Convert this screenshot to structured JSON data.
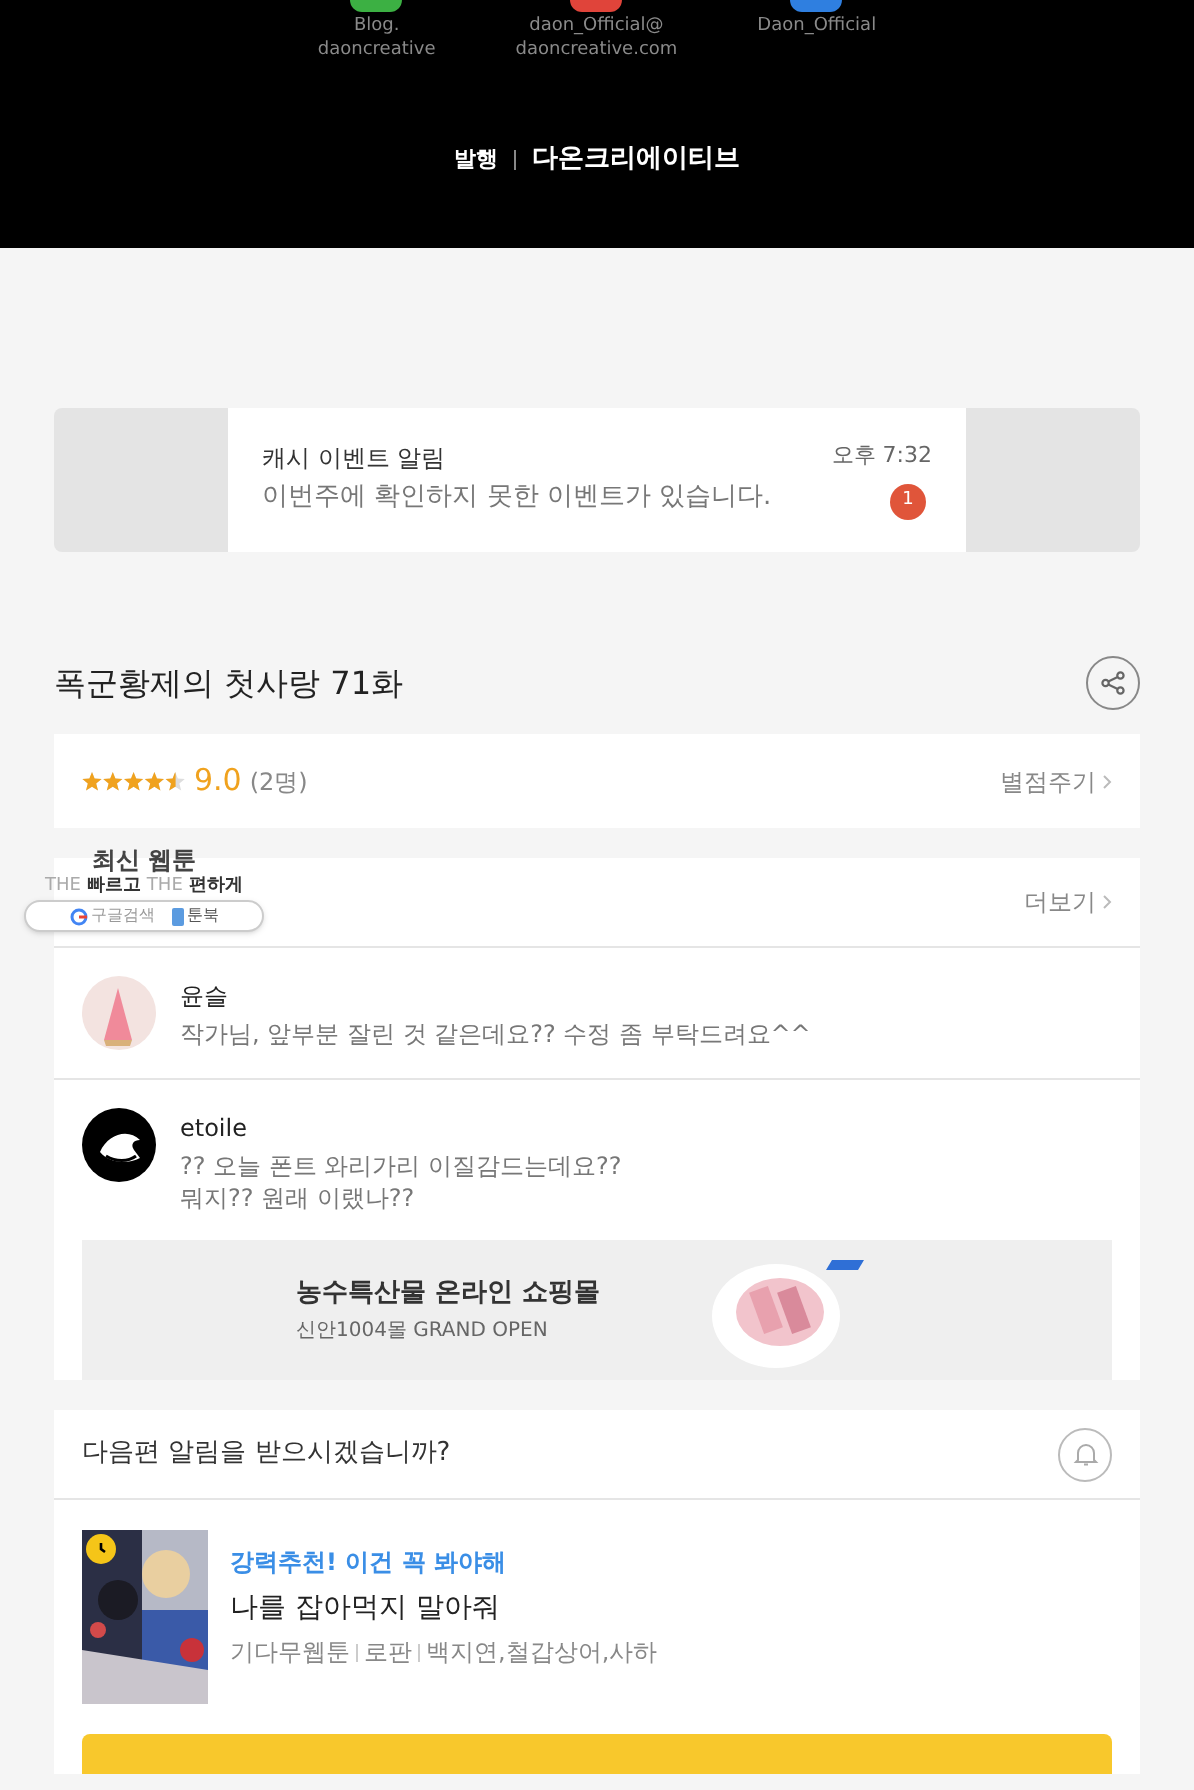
{
  "footer": {
    "links": [
      {
        "label": "Blog.\ndaoncreative",
        "color": "#3cb043"
      },
      {
        "label": "daon_Official@\ndaoncreative.com",
        "color": "#e0443a"
      },
      {
        "label": "Daon_Official",
        "color": "#2f7fe0"
      }
    ],
    "publisher_label": "발행",
    "publisher": "다온크리에이티브"
  },
  "notification": {
    "title": "캐시 이벤트 알림",
    "message": "이번주에 확인하지 못한 이벤트가 있습니다.",
    "time": "오후 7:32",
    "count": "1"
  },
  "episode": {
    "title": "폭군황제의 첫사랑 71화",
    "stars": 4.5,
    "score": "9.0",
    "votes": "(2명)",
    "rate_link": "별점주기"
  },
  "overlay_ad": {
    "title": "최신 웹툰",
    "slogan_parts": [
      "THE",
      "빠르고",
      "THE",
      "편하게"
    ],
    "search": "구글검색",
    "app": "툰북"
  },
  "comments": {
    "more": "더보기",
    "items": [
      {
        "author": "윤슬",
        "text": "작가님, 앞부분 잘린 것 같은데요?? 수정 좀 부탁드려요^^",
        "kind": "cone"
      },
      {
        "author": "etoile",
        "text": "?? 오늘 폰트 와리가리 이질감드는데요??\n뭐지?? 원래 이랬나??",
        "kind": "dark"
      }
    ]
  },
  "ad_banner": {
    "title": "농수특산물 온라인 쇼핑몰",
    "subtitle": "신안1004몰 GRAND OPEN"
  },
  "next_alert": {
    "question": "다음편 알림을 받으시겠습니까?"
  },
  "recommendation": {
    "tagline": "강력추천! 이건 꼭 봐야해",
    "title": "나를 잡아먹지 말아줘",
    "meta": [
      "기다무웹툰",
      "로판",
      "백지연,철갑상어,사하"
    ]
  }
}
